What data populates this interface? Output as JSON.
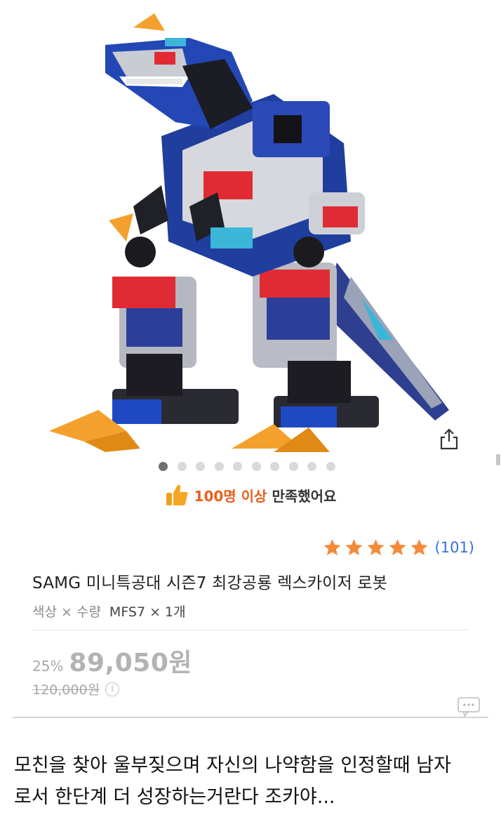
{
  "satisfaction": {
    "highlight": "100명 이상",
    "rest": "만족했어요",
    "icon": "thumbs-up-icon",
    "color": "#e8601c"
  },
  "carousel": {
    "total": 10,
    "active_index": 0
  },
  "rating": {
    "stars": 5,
    "count": "(101)",
    "star_color": "#f58a3a"
  },
  "product": {
    "title": "SAMG 미니특공대 시즌7 최강공룡 렉스카이저 로봇",
    "option_label": "색상 × 수량",
    "option_value": "MFS7 × 1개",
    "discount": "25%",
    "price": "89,050원",
    "original_price": "120,000원"
  },
  "caption": {
    "line1": "모친을 찾아 울부짖으며 자신의 나약함을 인정할때 남자",
    "line2": "로서 한단계 더 성장하는거란다 조카야..."
  },
  "icons": {
    "share": "share-icon",
    "info": "info-icon",
    "chat": "chat-bubble-icon"
  }
}
